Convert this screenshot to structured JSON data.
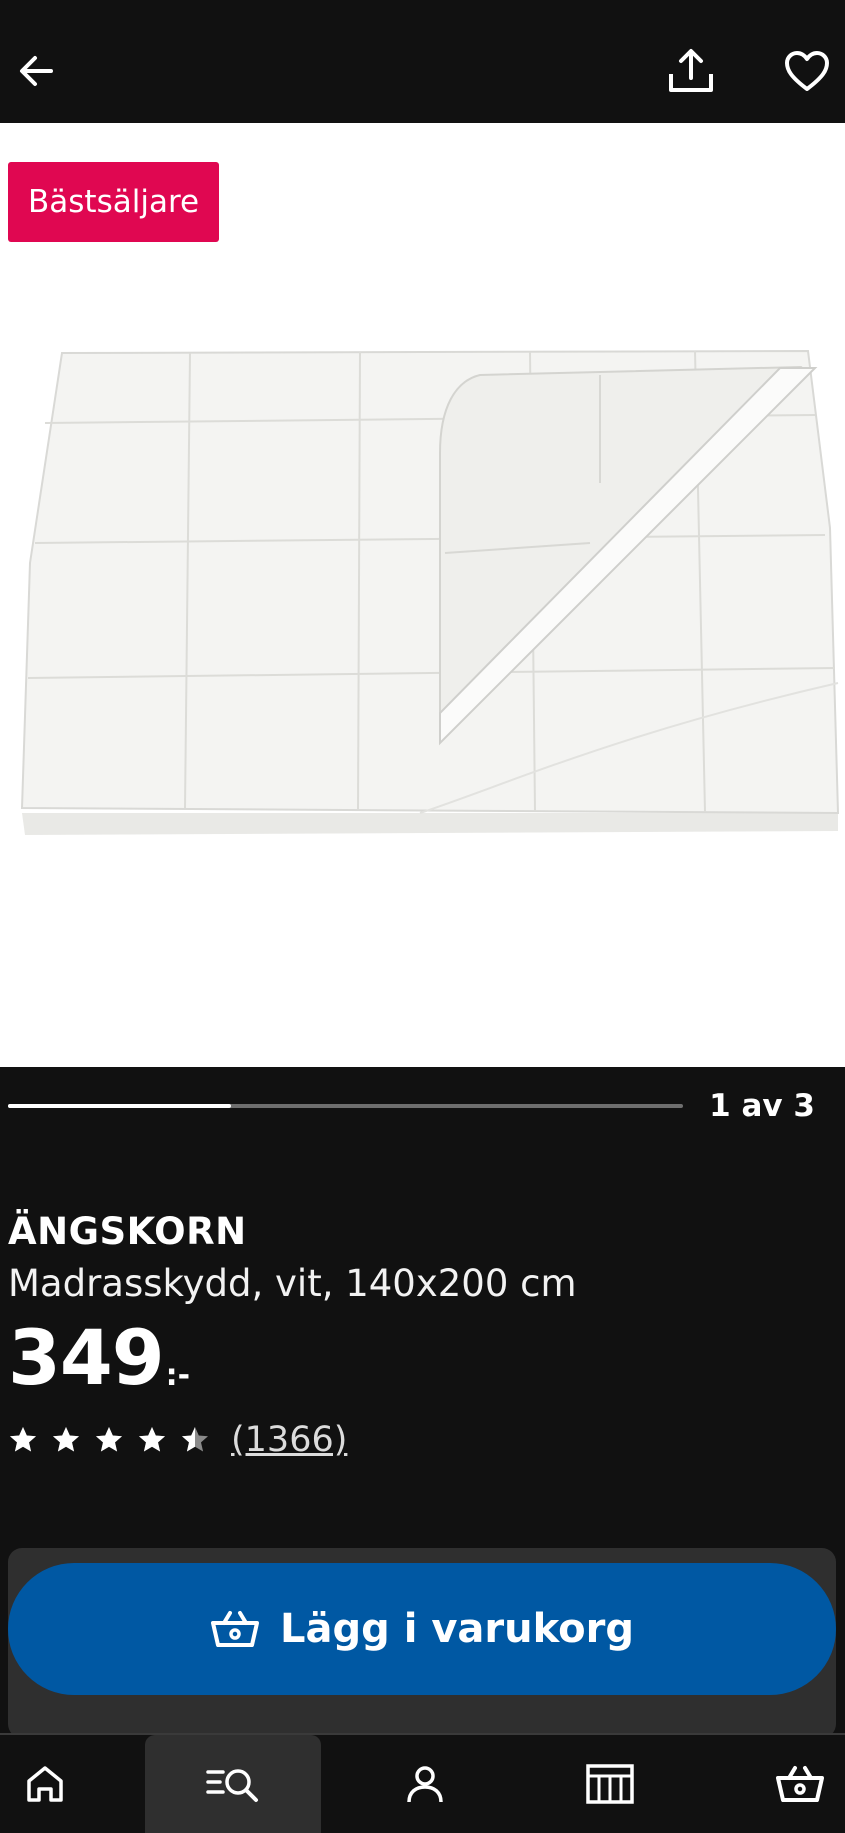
{
  "header": {
    "back_icon": "arrow-left-icon",
    "share_icon": "share-icon",
    "favourite_icon": "heart-icon"
  },
  "gallery": {
    "badge": "Bästsäljare",
    "counter": "1 av 3",
    "progress": 0.33
  },
  "product": {
    "name": "ÄNGSKORN",
    "description": "Madrasskydd, vit, 140x200 cm",
    "price": "349",
    "price_suffix": ":-",
    "rating": 4.5,
    "review_count": "(1366)"
  },
  "cart": {
    "label": "Lägg i varukorg",
    "icon": "basket-icon"
  },
  "bottom_nav": {
    "items": [
      {
        "icon": "home-icon"
      },
      {
        "icon": "search-icon",
        "active": true
      },
      {
        "icon": "profile-icon"
      },
      {
        "icon": "store-icon"
      },
      {
        "icon": "cart-icon"
      }
    ]
  },
  "colors": {
    "background": "#111111",
    "badge": "#e00751",
    "primary_button": "#0058a3"
  }
}
